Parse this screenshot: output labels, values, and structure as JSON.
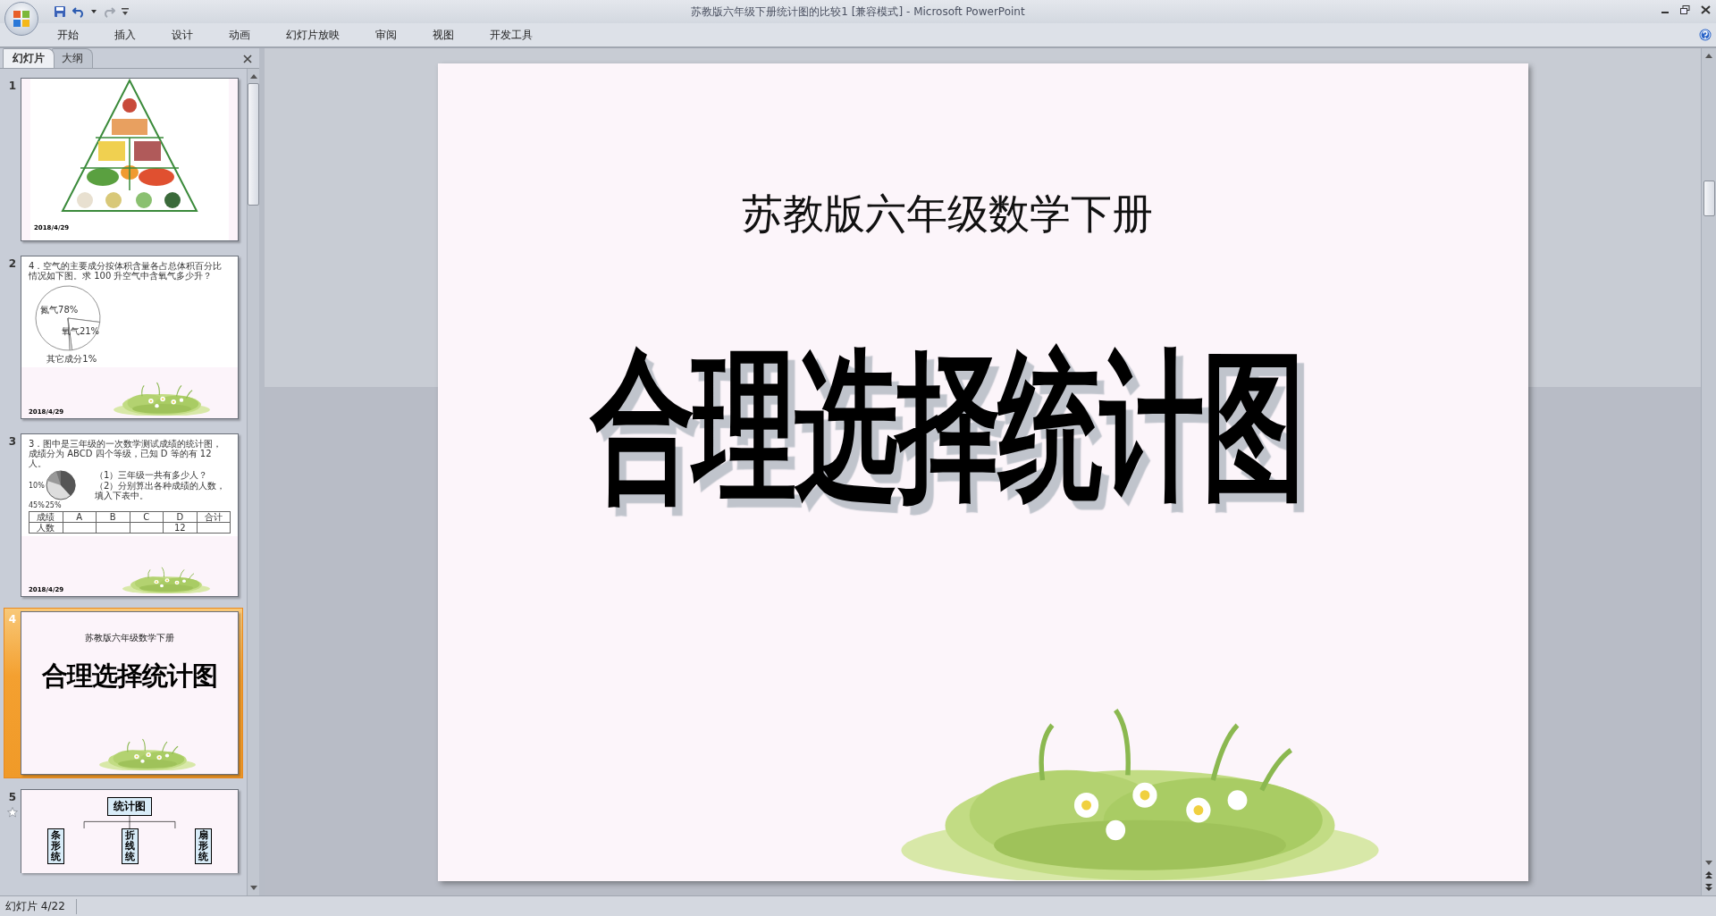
{
  "window": {
    "title": "苏教版六年级下册统计图的比较1 [兼容模式] - Microsoft PowerPoint"
  },
  "ribbon_tabs": [
    {
      "label": "开始"
    },
    {
      "label": "插入"
    },
    {
      "label": "设计"
    },
    {
      "label": "动画"
    },
    {
      "label": "幻灯片放映"
    },
    {
      "label": "审阅"
    },
    {
      "label": "视图"
    },
    {
      "label": "开发工具"
    }
  ],
  "panel_tabs": [
    {
      "label": "幻灯片",
      "selected": true
    },
    {
      "label": "大纲",
      "selected": false
    }
  ],
  "thumbnails": [
    {
      "number": "1",
      "kind": "pyramid",
      "selected": false,
      "animated": false,
      "date": "2018/4/29"
    },
    {
      "number": "2",
      "kind": "question_pie",
      "selected": false,
      "animated": false,
      "question": "4．空气的主要成分按体积含量各占总体积百分比情况如下图。求 100 升空气中含氧气多少升？",
      "chart_data": {
        "type": "pie",
        "categories": [
          "氮气",
          "氧气",
          "其它成分"
        ],
        "values": [
          78,
          21,
          1
        ],
        "value_labels": [
          "78%",
          "21%",
          "1%"
        ]
      },
      "date": "2018/4/29"
    },
    {
      "number": "3",
      "kind": "question_table",
      "selected": false,
      "animated": false,
      "question": "3．图中是三年级的一次数学测试成绩的统计图，成绩分为 ABCD 四个等级，已知 D 等的有 12 人。",
      "pie_labels": [
        "10%",
        "45%",
        "25%"
      ],
      "sub_questions": [
        "（1）三年级一共有多少人？",
        "（2）分别算出各种成绩的人数，填入下表中。"
      ],
      "table": {
        "columns": [
          "成绩",
          "A",
          "B",
          "C",
          "D",
          "合计"
        ],
        "rows": [
          [
            "人数",
            null,
            null,
            null,
            "12",
            null
          ]
        ]
      },
      "date": "2018/4/29"
    },
    {
      "number": "4",
      "kind": "title",
      "selected": true,
      "animated": false,
      "subtitle": "苏教版六年级数学下册",
      "title": "合理选择统计图"
    },
    {
      "number": "5",
      "kind": "diagram",
      "selected": false,
      "animated": true,
      "root": "统计图",
      "branches": [
        "条形统",
        "折线统",
        "扇形统"
      ]
    }
  ],
  "slide": {
    "subtitle": "苏教版六年级数学下册",
    "title": "合理选择统计图"
  },
  "status_bar": {
    "slide_indicator": "幻灯片 4/22"
  }
}
